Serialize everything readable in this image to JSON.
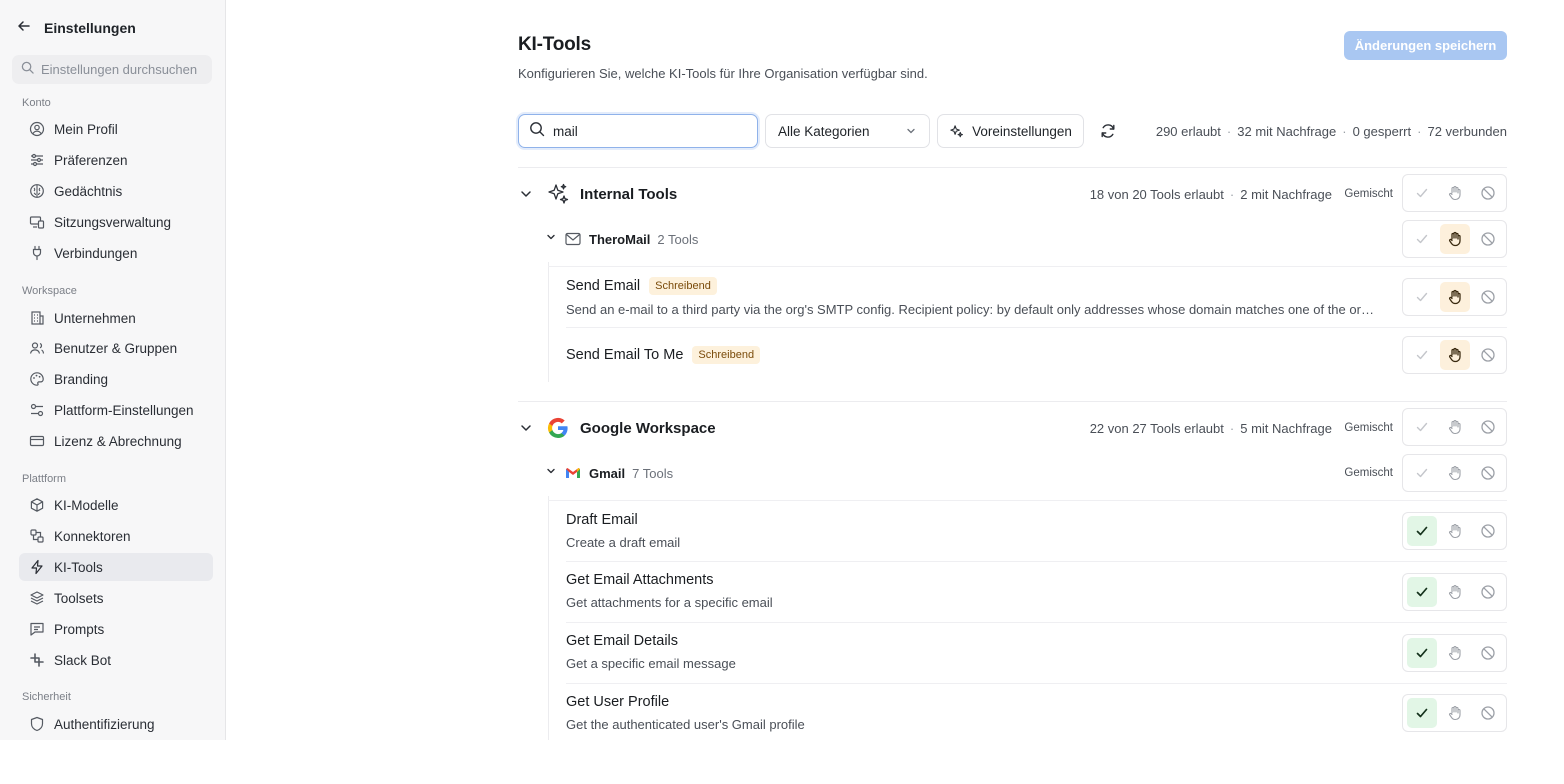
{
  "sidebar": {
    "back_icon": "arrow-left-icon",
    "title": "Einstellungen",
    "search_placeholder": "Einstellungen durchsuchen",
    "sections": {
      "konto": "Konto",
      "workspace": "Workspace",
      "plattform": "Plattform",
      "sicherheit": "Sicherheit"
    },
    "items": [
      {
        "label": "Mein Profil",
        "icon": "user-circle-icon"
      },
      {
        "label": "Präferenzen",
        "icon": "sliders-icon"
      },
      {
        "label": "Gedächtnis",
        "icon": "brain-icon"
      },
      {
        "label": "Sitzungsverwaltung",
        "icon": "devices-icon"
      },
      {
        "label": "Verbindungen",
        "icon": "plug-icon"
      },
      {
        "label": "Unternehmen",
        "icon": "building-icon"
      },
      {
        "label": "Benutzer & Gruppen",
        "icon": "users-icon"
      },
      {
        "label": "Branding",
        "icon": "palette-icon"
      },
      {
        "label": "Plattform-Einstellungen",
        "icon": "settings-sliders-icon"
      },
      {
        "label": "Lizenz & Abrechnung",
        "icon": "credit-card-icon"
      },
      {
        "label": "KI-Modelle",
        "icon": "cube-icon"
      },
      {
        "label": "Konnektoren",
        "icon": "connector-icon"
      },
      {
        "label": "KI-Tools",
        "icon": "zap-icon"
      },
      {
        "label": "Toolsets",
        "icon": "layers-icon"
      },
      {
        "label": "Prompts",
        "icon": "message-icon"
      },
      {
        "label": "Slack Bot",
        "icon": "slack-icon"
      },
      {
        "label": "Authentifizierung",
        "icon": "shield-icon"
      }
    ],
    "active_item": "KI-Tools"
  },
  "header": {
    "title": "KI-Tools",
    "subtitle": "Konfigurieren Sie, welche KI-Tools für Ihre Organisation verfügbar sind.",
    "save_label": "Änderungen speichern"
  },
  "toolbar": {
    "search_value": "mail",
    "category_value": "Alle Kategorien",
    "presets_label": "Voreinstellungen",
    "stats": {
      "allowed": "290 erlaubt",
      "on_request": "32 mit Nachfrage",
      "blocked": "0 gesperrt",
      "connected": "72 verbunden"
    }
  },
  "mixed_label": "Gemischt",
  "colors": {
    "accent_disabled": "#a9c7f2",
    "allow_green": "#1f7a34",
    "ask_amber": "#b8650a",
    "badge_bg": "#fdf1dc"
  },
  "groups": [
    {
      "name": "Internal Tools",
      "icon": "sparkles-icon",
      "allowed_text": "18 von 20 Tools erlaubt",
      "ask_text": "2 mit Nachfrage",
      "status": "Gemischt",
      "subgroup": {
        "name": "TheroMail",
        "count": "2 Tools",
        "icon": "mail-icon",
        "state": "ask"
      },
      "tools": [
        {
          "name": "Send Email",
          "badge": "Schreibend",
          "description": "Send an e-mail to a third party via the org's SMTP config. Recipient policy: by default only addresses whose domain matches one of the org's verified domains are allowed.",
          "state": "ask"
        },
        {
          "name": "Send Email To Me",
          "badge": "Schreibend",
          "description": "",
          "state": "ask"
        }
      ]
    },
    {
      "name": "Google Workspace",
      "icon": "google-icon",
      "allowed_text": "22 von 27 Tools erlaubt",
      "ask_text": "5 mit Nachfrage",
      "status": "Gemischt",
      "subgroup": {
        "name": "Gmail",
        "count": "7 Tools",
        "icon": "gmail-icon",
        "status": "Gemischt",
        "state": "mixed"
      },
      "tools": [
        {
          "name": "Draft Email",
          "description": "Create a draft email",
          "state": "allow"
        },
        {
          "name": "Get Email Attachments",
          "description": "Get attachments for a specific email",
          "state": "allow"
        },
        {
          "name": "Get Email Details",
          "description": "Get a specific email message",
          "state": "allow"
        },
        {
          "name": "Get User Profile",
          "description": "Get the authenticated user's Gmail profile",
          "state": "allow"
        }
      ]
    }
  ]
}
